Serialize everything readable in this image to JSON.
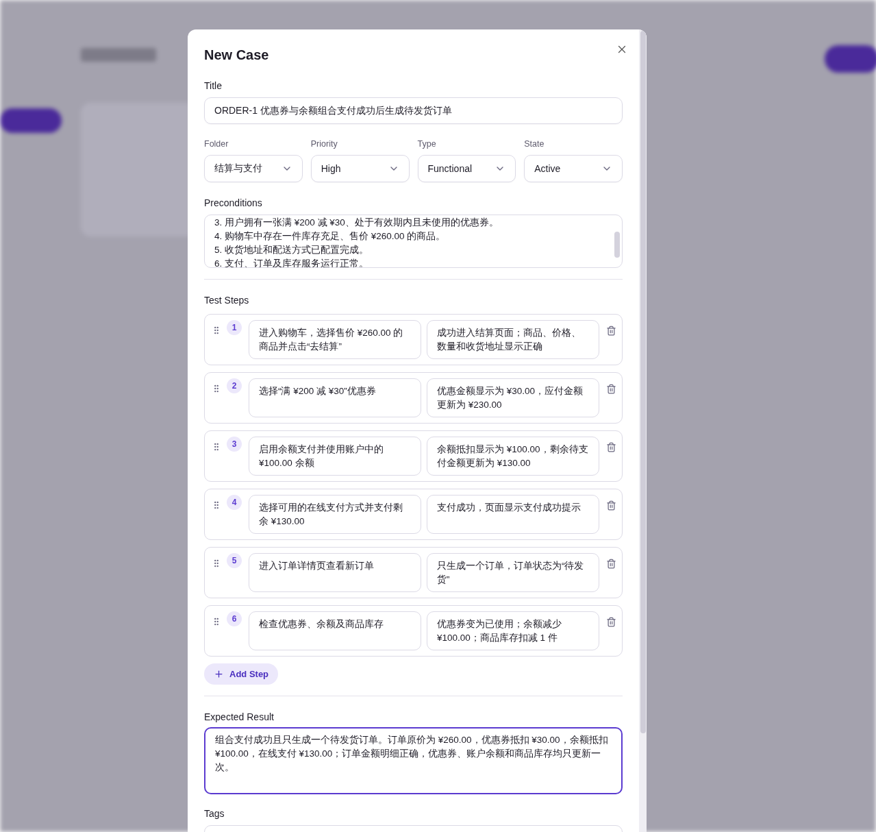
{
  "dialog": {
    "title": "New Case",
    "title_field": {
      "label": "Title",
      "value": "ORDER-1 优惠券与余额组合支付成功后生成待发货订单"
    },
    "selects": [
      {
        "label": "Folder",
        "value": "结算与支付"
      },
      {
        "label": "Priority",
        "value": "High"
      },
      {
        "label": "Type",
        "value": "Functional"
      },
      {
        "label": "State",
        "value": "Active"
      }
    ],
    "preconditions": {
      "label": "Preconditions",
      "lines": [
        "3. 用户拥有一张满 ¥200 减 ¥30、处于有效期内且未使用的优惠券。",
        "4. 购物车中存在一件库存充足、售价 ¥260.00 的商品。",
        "5. 收货地址和配送方式已配置完成。",
        "6. 支付、订单及库存服务运行正常。"
      ]
    },
    "steps": {
      "label": "Test Steps",
      "items": [
        {
          "number": "1",
          "action": "进入购物车，选择售价 ¥260.00 的商品并点击“去结算”",
          "expected": "成功进入结算页面；商品、价格、数量和收货地址显示正确"
        },
        {
          "number": "2",
          "action": "选择“满 ¥200 减 ¥30”优惠券",
          "expected": "优惠金额显示为 ¥30.00，应付金额更新为 ¥230.00"
        },
        {
          "number": "3",
          "action": "启用余额支付并使用账户中的 ¥100.00 余额",
          "expected": "余额抵扣显示为 ¥100.00，剩余待支付金额更新为 ¥130.00"
        },
        {
          "number": "4",
          "action": "选择可用的在线支付方式并支付剩余 ¥130.00",
          "expected": "支付成功，页面显示支付成功提示"
        },
        {
          "number": "5",
          "action": "进入订单详情页查看新订单",
          "expected": "只生成一个订单，订单状态为“待发货”"
        },
        {
          "number": "6",
          "action": "检查优惠券、余额及商品库存",
          "expected": "优惠券变为已使用；余额减少 ¥100.00；商品库存扣减 1 件"
        }
      ],
      "add_label": "Add Step"
    },
    "expected_result": {
      "label": "Expected Result",
      "value": "组合支付成功且只生成一个待发货订单。订单原价为 ¥260.00，优惠券抵扣 ¥30.00，余额抵扣 ¥100.00，在线支付 ¥130.00；订单金额明细正确，优惠券、账户余额和商品库存均只更新一次。",
      "focused": true
    },
    "tags": {
      "label": "Tags"
    }
  }
}
